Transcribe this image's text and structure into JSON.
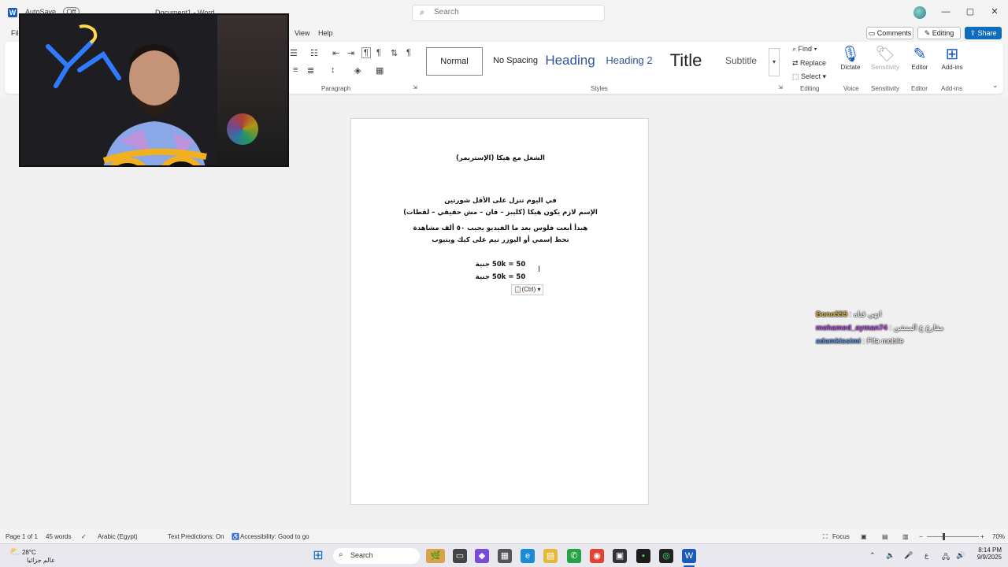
{
  "titlebar": {
    "autosave_label": "AutoSave",
    "autosave_state": "Off",
    "doc_title": "Document1 - Word",
    "search_placeholder": "Search",
    "minimize": "—",
    "maximize": "▢",
    "close": "✕"
  },
  "tabs": {
    "file": "File",
    "view": "View",
    "help": "Help"
  },
  "actions": {
    "comments": "Comments",
    "editing": "Editing",
    "share": "Share"
  },
  "ribbon": {
    "paragraph_label": "Paragraph",
    "styles_label": "Styles",
    "editing_label": "Editing",
    "voice_label": "Voice",
    "sensitivity_label": "Sensitivity",
    "editor_label": "Editor",
    "addins_label": "Add-ins",
    "styles": [
      "Normal",
      "No Spacing",
      "Heading",
      "Heading 2",
      "Title",
      "Subtitle"
    ],
    "find": "Find",
    "replace": "Replace",
    "select": "Select",
    "dictate": "Dictate",
    "sensitivity": "Sensitivity",
    "editor": "Editor",
    "addins": "Add-ins"
  },
  "document": {
    "title_line": "الشغل مع هيكا (الإستريمر)",
    "line1": "في اليوم تنزل على الأقل شورتين",
    "line2": "الإسم لازم يكون هيكا (كليبز – فان – مش حقيقي – لقطات)",
    "line3": "هبدأ أبعت فلوس بعد ما الفيديو يجيب ٥٠ ألف مشاهدة",
    "line4": "تحط إسمي أو اليوزر نيم على كيك ويتيوب",
    "line5": "50k = 50 جنية",
    "line6": "50k = 50 جنية",
    "paste_options": "(Ctrl)"
  },
  "chat": [
    {
      "user": "Bono555",
      "sep": " : ",
      "message": "انهي قناه",
      "color": "#d4b24a"
    },
    {
      "user": "mohamed_ayman74",
      "sep": " : ",
      "message": "مقارع ع المنشن",
      "color": "#b24fd8"
    },
    {
      "user": "adamkissimi",
      "sep": " : ",
      "message": "Fifa mobile",
      "color": "#5a8fd8"
    }
  ],
  "statusbar": {
    "page": "Page 1 of 1",
    "words": "45 words",
    "language": "Arabic (Egypt)",
    "predictions": "Text Predictions: On",
    "accessibility": "Accessibility: Good to go",
    "focus": "Focus",
    "zoom": "70%"
  },
  "taskbar": {
    "temperature": "28°C",
    "weather_text": "عالم جزائيا",
    "search_label": "Search",
    "time": "8:14 PM",
    "date": "9/9/2025",
    "lang": "ع"
  },
  "colors": {
    "share_bg": "#0f6cbd",
    "heading_blue": "#2f5597",
    "word_blue": "#185abd"
  }
}
